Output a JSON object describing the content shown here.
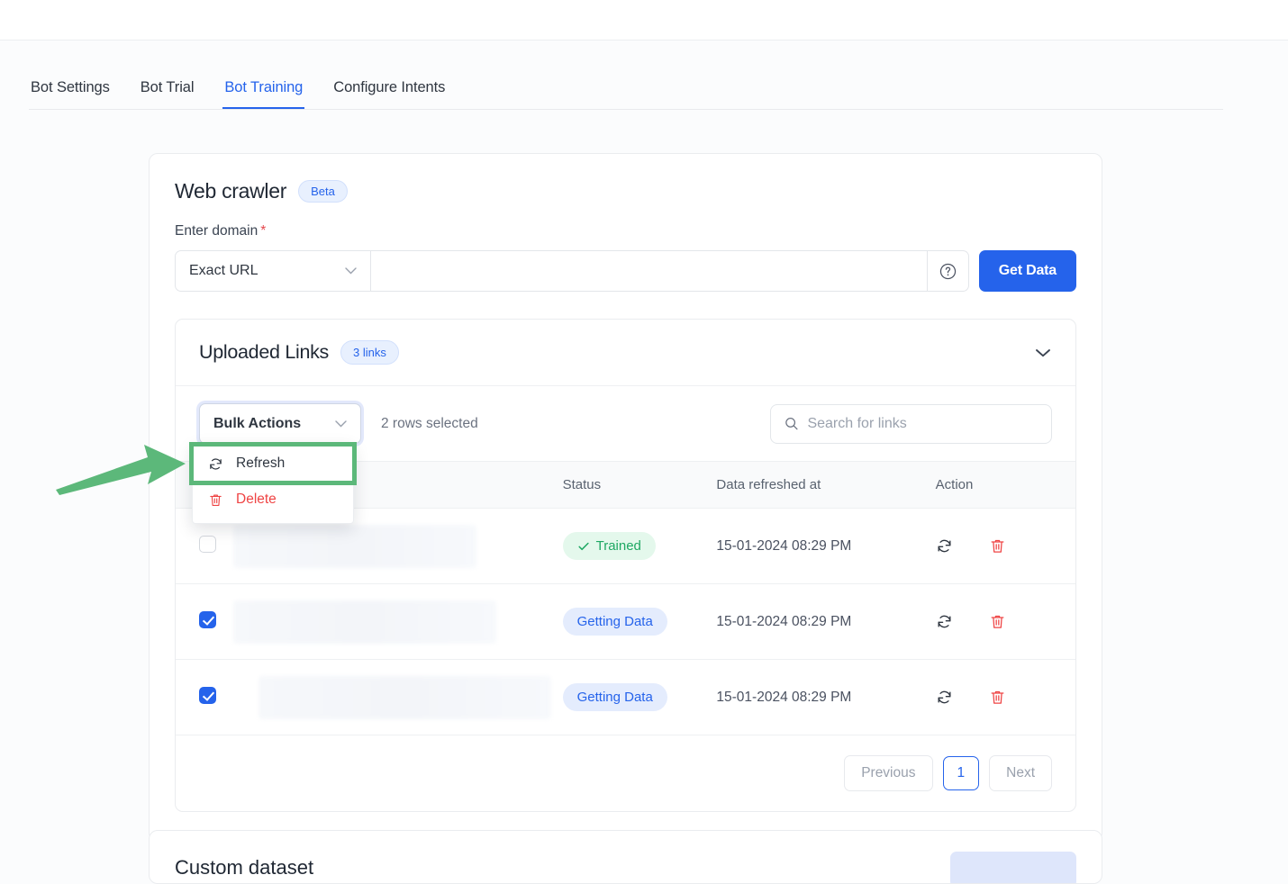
{
  "tabs": [
    {
      "label": "Bot Settings",
      "active": false
    },
    {
      "label": "Bot Trial",
      "active": false
    },
    {
      "label": "Bot Training",
      "active": true
    },
    {
      "label": "Configure Intents",
      "active": false
    }
  ],
  "crawler": {
    "title": "Web crawler",
    "badge": "Beta",
    "field_label": "Enter domain",
    "required_mark": "*",
    "mode_select_value": "Exact URL",
    "url_value": "",
    "url_placeholder": "",
    "help_icon": "question-circle-icon",
    "get_data_label": "Get Data"
  },
  "uploaded_links": {
    "title": "Uploaded Links",
    "count_pill": "3 links",
    "collapse_icon": "chevron-down-icon"
  },
  "toolbar": {
    "bulk_actions_label": "Bulk Actions",
    "bulk_actions_caret": "chevron-down-icon",
    "rows_selected_text": "2 rows selected",
    "search_placeholder": "Search for links",
    "search_value": "",
    "search_icon": "search-icon"
  },
  "bulk_menu": {
    "open": true,
    "items": [
      {
        "label": "Refresh",
        "icon": "refresh-icon",
        "danger": false,
        "highlighted": true
      },
      {
        "label": "Delete",
        "icon": "trash-icon",
        "danger": true,
        "highlighted": false
      }
    ]
  },
  "table": {
    "columns": [
      "",
      "",
      "Status",
      "Data refreshed at",
      "Action"
    ],
    "rows": [
      {
        "selected": false,
        "link_redacted": true,
        "status": "Trained",
        "status_type": "trained",
        "refreshed_at": "15-01-2024 08:29 PM",
        "actions": [
          "refresh-icon",
          "trash-icon"
        ]
      },
      {
        "selected": true,
        "link_redacted": true,
        "status": "Getting Data",
        "status_type": "getting",
        "refreshed_at": "15-01-2024 08:29 PM",
        "actions": [
          "refresh-icon",
          "trash-icon"
        ]
      },
      {
        "selected": true,
        "link_redacted": true,
        "status": "Getting Data",
        "status_type": "getting",
        "refreshed_at": "15-01-2024 08:29 PM",
        "actions": [
          "refresh-icon",
          "trash-icon"
        ]
      }
    ]
  },
  "pagination": {
    "previous_label": "Previous",
    "page_number": "1",
    "next_label": "Next"
  },
  "bottom_card": {
    "title": "Custom dataset"
  },
  "annotation": {
    "arrow_color": "#5cb87a",
    "highlight_color": "#5cb87a",
    "points_to": "Refresh"
  },
  "colors": {
    "accent": "#2563eb",
    "success": "#1ea863",
    "danger": "#ef4444",
    "page_bg": "#fbfcfd"
  }
}
